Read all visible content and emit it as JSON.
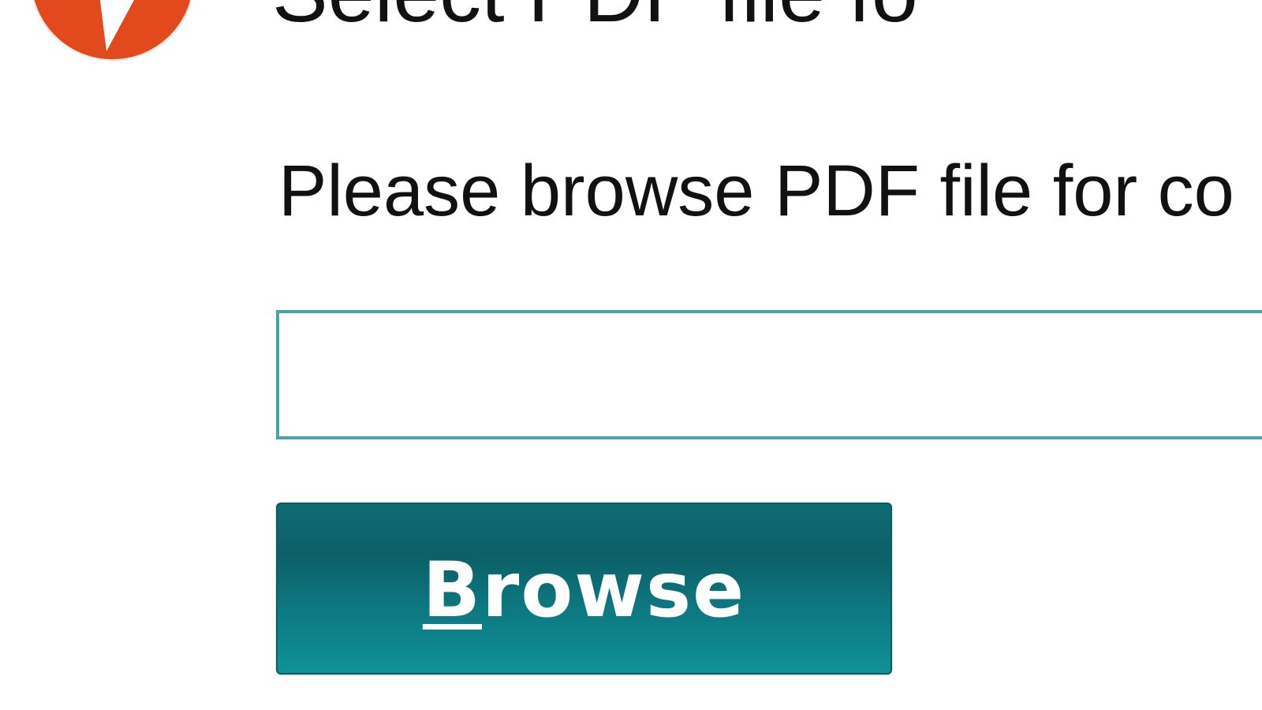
{
  "header": {
    "title": "Select PDF file fo",
    "step_icon": "arrow-marker-icon",
    "step_icon_color": "#e2491c"
  },
  "instruction": {
    "text": "Please browse PDF file for co"
  },
  "file_input": {
    "value": "",
    "border_color": "#4aa5a8"
  },
  "browse_button": {
    "label_mnemonic": "B",
    "label_rest": "rowse",
    "color": "#0f7e85"
  }
}
